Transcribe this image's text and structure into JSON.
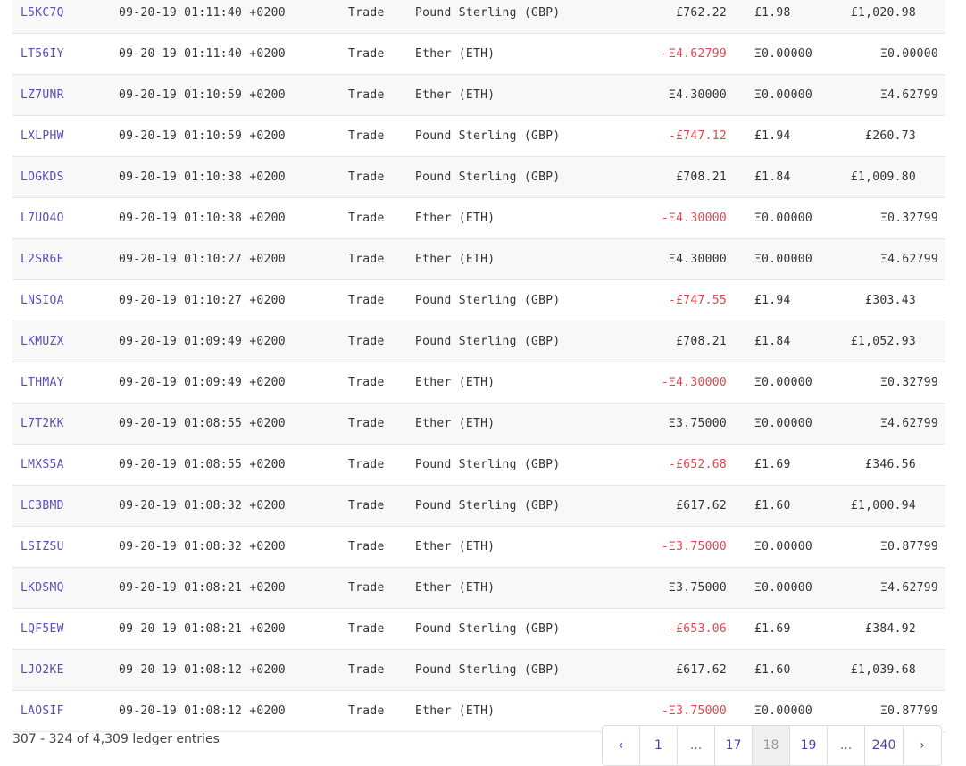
{
  "rows": [
    {
      "id": "L5KC7Q",
      "date": "09-20-19 01:11:40 +0200",
      "type": "Trade",
      "asset": "Pound Sterling (GBP)",
      "amount": "£762.22",
      "fee": "£1.98",
      "balance": "£1,020.98",
      "negative": false,
      "currency": "gbp"
    },
    {
      "id": "LT56IY",
      "date": "09-20-19 01:11:40 +0200",
      "type": "Trade",
      "asset": "Ether (ETH)",
      "amount": "-Ξ4.62799",
      "fee": "Ξ0.00000",
      "balance": "Ξ0.00000",
      "negative": true,
      "currency": "eth"
    },
    {
      "id": "LZ7UNR",
      "date": "09-20-19 01:10:59 +0200",
      "type": "Trade",
      "asset": "Ether (ETH)",
      "amount": "Ξ4.30000",
      "fee": "Ξ0.00000",
      "balance": "Ξ4.62799",
      "negative": false,
      "currency": "eth"
    },
    {
      "id": "LXLPHW",
      "date": "09-20-19 01:10:59 +0200",
      "type": "Trade",
      "asset": "Pound Sterling (GBP)",
      "amount": "-£747.12",
      "fee": "£1.94",
      "balance": "£260.73",
      "negative": true,
      "currency": "gbp"
    },
    {
      "id": "LOGKDS",
      "date": "09-20-19 01:10:38 +0200",
      "type": "Trade",
      "asset": "Pound Sterling (GBP)",
      "amount": "£708.21",
      "fee": "£1.84",
      "balance": "£1,009.80",
      "negative": false,
      "currency": "gbp"
    },
    {
      "id": "L7UO4O",
      "date": "09-20-19 01:10:38 +0200",
      "type": "Trade",
      "asset": "Ether (ETH)",
      "amount": "-Ξ4.30000",
      "fee": "Ξ0.00000",
      "balance": "Ξ0.32799",
      "negative": true,
      "currency": "eth"
    },
    {
      "id": "L2SR6E",
      "date": "09-20-19 01:10:27 +0200",
      "type": "Trade",
      "asset": "Ether (ETH)",
      "amount": "Ξ4.30000",
      "fee": "Ξ0.00000",
      "balance": "Ξ4.62799",
      "negative": false,
      "currency": "eth"
    },
    {
      "id": "LNSIQA",
      "date": "09-20-19 01:10:27 +0200",
      "type": "Trade",
      "asset": "Pound Sterling (GBP)",
      "amount": "-£747.55",
      "fee": "£1.94",
      "balance": "£303.43",
      "negative": true,
      "currency": "gbp"
    },
    {
      "id": "LKMUZX",
      "date": "09-20-19 01:09:49 +0200",
      "type": "Trade",
      "asset": "Pound Sterling (GBP)",
      "amount": "£708.21",
      "fee": "£1.84",
      "balance": "£1,052.93",
      "negative": false,
      "currency": "gbp"
    },
    {
      "id": "LTHMAY",
      "date": "09-20-19 01:09:49 +0200",
      "type": "Trade",
      "asset": "Ether (ETH)",
      "amount": "-Ξ4.30000",
      "fee": "Ξ0.00000",
      "balance": "Ξ0.32799",
      "negative": true,
      "currency": "eth"
    },
    {
      "id": "L7T2KK",
      "date": "09-20-19 01:08:55 +0200",
      "type": "Trade",
      "asset": "Ether (ETH)",
      "amount": "Ξ3.75000",
      "fee": "Ξ0.00000",
      "balance": "Ξ4.62799",
      "negative": false,
      "currency": "eth"
    },
    {
      "id": "LMXS5A",
      "date": "09-20-19 01:08:55 +0200",
      "type": "Trade",
      "asset": "Pound Sterling (GBP)",
      "amount": "-£652.68",
      "fee": "£1.69",
      "balance": "£346.56",
      "negative": true,
      "currency": "gbp"
    },
    {
      "id": "LC3BMD",
      "date": "09-20-19 01:08:32 +0200",
      "type": "Trade",
      "asset": "Pound Sterling (GBP)",
      "amount": "£617.62",
      "fee": "£1.60",
      "balance": "£1,000.94",
      "negative": false,
      "currency": "gbp"
    },
    {
      "id": "LSIZSU",
      "date": "09-20-19 01:08:32 +0200",
      "type": "Trade",
      "asset": "Ether (ETH)",
      "amount": "-Ξ3.75000",
      "fee": "Ξ0.00000",
      "balance": "Ξ0.87799",
      "negative": true,
      "currency": "eth"
    },
    {
      "id": "LKDSMQ",
      "date": "09-20-19 01:08:21 +0200",
      "type": "Trade",
      "asset": "Ether (ETH)",
      "amount": "Ξ3.75000",
      "fee": "Ξ0.00000",
      "balance": "Ξ4.62799",
      "negative": false,
      "currency": "eth"
    },
    {
      "id": "LQF5EW",
      "date": "09-20-19 01:08:21 +0200",
      "type": "Trade",
      "asset": "Pound Sterling (GBP)",
      "amount": "-£653.06",
      "fee": "£1.69",
      "balance": "£384.92",
      "negative": true,
      "currency": "gbp"
    },
    {
      "id": "LJO2KE",
      "date": "09-20-19 01:08:12 +0200",
      "type": "Trade",
      "asset": "Pound Sterling (GBP)",
      "amount": "£617.62",
      "fee": "£1.60",
      "balance": "£1,039.68",
      "negative": false,
      "currency": "gbp"
    },
    {
      "id": "LAOSIF",
      "date": "09-20-19 01:08:12 +0200",
      "type": "Trade",
      "asset": "Ether (ETH)",
      "amount": "-Ξ3.75000",
      "fee": "Ξ0.00000",
      "balance": "Ξ0.87799",
      "negative": true,
      "currency": "eth"
    }
  ],
  "footer": {
    "summary": "307 - 324 of 4,309 ledger entries"
  },
  "pagination": {
    "prev": "‹",
    "pages": [
      "1",
      "...",
      "17",
      "18",
      "19",
      "...",
      "240"
    ],
    "active": "18",
    "next": "›"
  },
  "colors": {
    "link": "#5b4fb0",
    "negative": "#e0474c",
    "row_alt": "#f8f8f8"
  }
}
